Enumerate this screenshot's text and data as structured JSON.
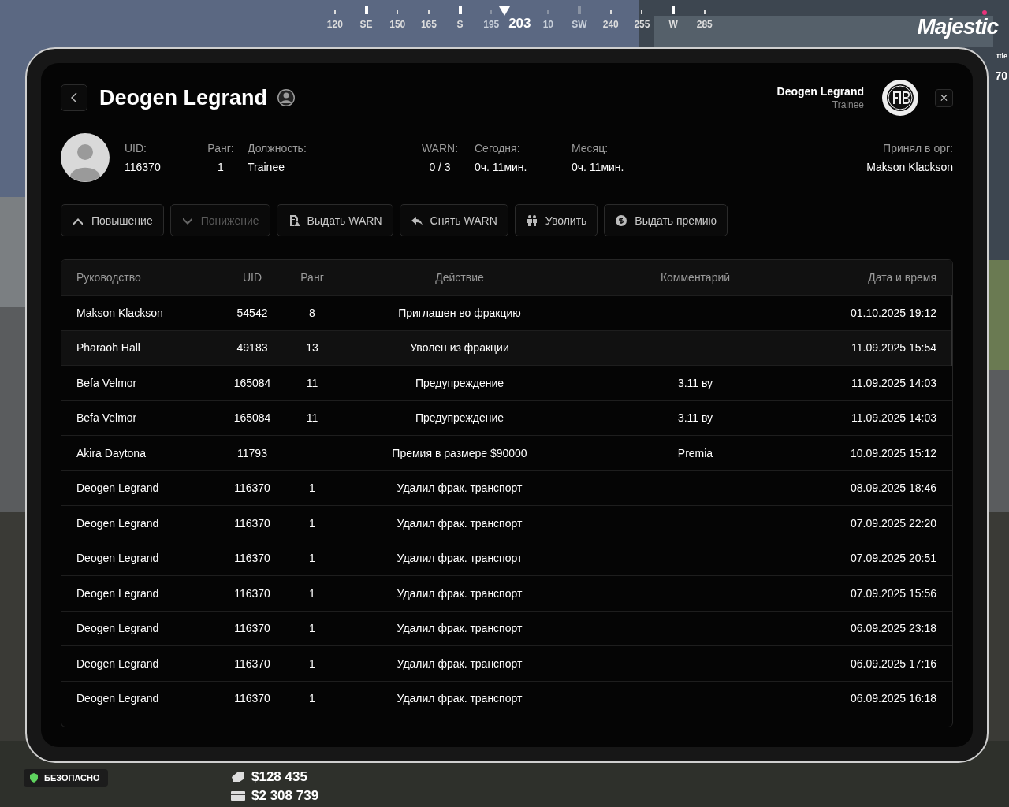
{
  "compass": {
    "marks": [
      {
        "label": "120",
        "major": false,
        "dim": false
      },
      {
        "label": "SE",
        "major": true,
        "dim": false
      },
      {
        "label": "150",
        "major": false,
        "dim": false
      },
      {
        "label": "165",
        "major": false,
        "dim": false
      },
      {
        "label": "S",
        "major": true,
        "dim": false
      },
      {
        "label": "195",
        "major": false,
        "dim": true
      },
      {
        "label": "10",
        "major": false,
        "dim": true
      },
      {
        "label": "SW",
        "major": true,
        "dim": true
      },
      {
        "label": "240",
        "major": false,
        "dim": false
      },
      {
        "label": "255",
        "major": false,
        "dim": false
      },
      {
        "label": "W",
        "major": true,
        "dim": false
      },
      {
        "label": "285",
        "major": false,
        "dim": false
      }
    ],
    "heading": "203"
  },
  "logo": "Majestic",
  "side_hud": [
    "ttle",
    "70"
  ],
  "profile": {
    "name": "Deogen Legrand",
    "fields": [
      {
        "label": "UID:",
        "value": "116370"
      },
      {
        "label": "Ранг:",
        "value": "1"
      },
      {
        "label": "Должность:",
        "value": "Trainee"
      },
      {
        "label": "WARN:",
        "value": "0 / 3"
      },
      {
        "label": "Сегодня:",
        "value": "0ч. 11мин."
      },
      {
        "label": "Месяц:",
        "value": "0ч. 11мин."
      },
      {
        "label": "Принял в орг:",
        "value": "Makson Klackson"
      }
    ]
  },
  "user": {
    "name": "Deogen Legrand",
    "rank": "Trainee"
  },
  "actions": [
    {
      "label": "Повышение",
      "disabled": false
    },
    {
      "label": "Понижение",
      "disabled": true
    },
    {
      "label": "Выдать WARN",
      "disabled": false
    },
    {
      "label": "Снять WARN",
      "disabled": false
    },
    {
      "label": "Уволить",
      "disabled": false
    },
    {
      "label": "Выдать премию",
      "disabled": false
    }
  ],
  "table": {
    "columns": [
      "Руководство",
      "UID",
      "Ранг",
      "Действие",
      "Комментарий",
      "Дата и время"
    ],
    "rows": [
      {
        "cells": [
          "Makson Klackson",
          "54542",
          "8",
          "Приглашен во фракцию",
          "",
          "01.10.2025 19:12"
        ],
        "selected": false
      },
      {
        "cells": [
          "Pharaoh Hall",
          "49183",
          "13",
          "Уволен из фракции",
          "",
          "11.09.2025 15:54"
        ],
        "selected": true
      },
      {
        "cells": [
          "Befa Velmor",
          "165084",
          "11",
          "Предупреждение",
          "3.11 ву",
          "11.09.2025 14:03"
        ],
        "selected": false
      },
      {
        "cells": [
          "Befa Velmor",
          "165084",
          "11",
          "Предупреждение",
          "3.11 ву",
          "11.09.2025 14:03"
        ],
        "selected": false
      },
      {
        "cells": [
          "Akira Daytona",
          "11793",
          "",
          "Премия в размере $90000",
          "Premia",
          "10.09.2025 15:12"
        ],
        "selected": false
      },
      {
        "cells": [
          "Deogen Legrand",
          "116370",
          "1",
          "Удалил фрак. транспорт",
          "",
          "08.09.2025 18:46"
        ],
        "selected": false
      },
      {
        "cells": [
          "Deogen Legrand",
          "116370",
          "1",
          "Удалил фрак. транспорт",
          "",
          "07.09.2025 22:20"
        ],
        "selected": false
      },
      {
        "cells": [
          "Deogen Legrand",
          "116370",
          "1",
          "Удалил фрак. транспорт",
          "",
          "07.09.2025 20:51"
        ],
        "selected": false
      },
      {
        "cells": [
          "Deogen Legrand",
          "116370",
          "1",
          "Удалил фрак. транспорт",
          "",
          "07.09.2025 15:56"
        ],
        "selected": false
      },
      {
        "cells": [
          "Deogen Legrand",
          "116370",
          "1",
          "Удалил фрак. транспорт",
          "",
          "06.09.2025 23:18"
        ],
        "selected": false
      },
      {
        "cells": [
          "Deogen Legrand",
          "116370",
          "1",
          "Удалил фрак. транспорт",
          "",
          "06.09.2025 17:16"
        ],
        "selected": false
      },
      {
        "cells": [
          "Deogen Legrand",
          "116370",
          "1",
          "Удалил фрак. транспорт",
          "",
          "06.09.2025 16:18"
        ],
        "selected": false
      }
    ]
  },
  "hud": {
    "status": "БЕЗОПАСНО",
    "cash": "$128 435",
    "bank": "$2 308 739"
  }
}
